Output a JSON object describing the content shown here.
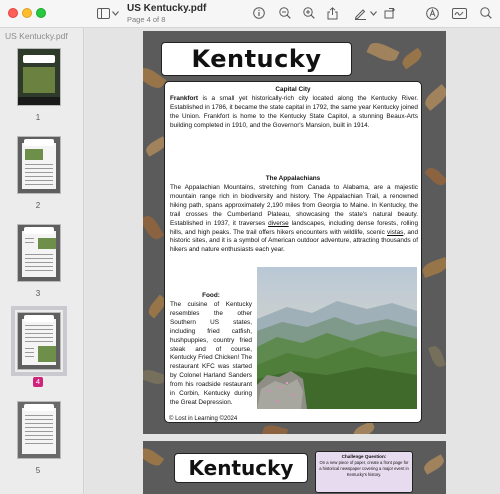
{
  "window": {
    "doc_title": "US Kentucky.pdf",
    "page_indicator": "Page 4 of 8"
  },
  "toolbar": {
    "icons": [
      "sidebar-toggle-icon",
      "chevron-down-icon",
      "info-icon",
      "zoom-out-icon",
      "zoom-in-icon",
      "share-icon",
      "markup-pen-icon",
      "chevron-down-icon",
      "rotate-icon",
      "highlight-icon",
      "signature-icon",
      "search-icon"
    ]
  },
  "sidebar": {
    "title": "US Kentucky.pdf",
    "thumbnails": [
      {
        "page": "1"
      },
      {
        "page": "2"
      },
      {
        "page": "3"
      },
      {
        "page": "4",
        "current": true
      },
      {
        "page": "5"
      }
    ]
  },
  "page": {
    "title": "Kentucky",
    "capital_heading": "Capital City",
    "capital_text": "is a small yet historically-rich city located along the Kentucky River. Established in 1786, it became the state capital in 1792, the same year Kentucky joined the Union. Frankfort is home to the Kentucky State Capitol, a stunning Beaux-Arts building completed in 1910, and the Governor's Mansion, built in 1914.",
    "capital_lead": "Frankfort",
    "appalachians_heading": "The Appalachians",
    "appalachians_text_1": "The Appalachian Mountains, stretching from Canada to Alabama, are a majestic mountain range rich in biodiversity and history. The Appalachian Trail, a renowned hiking path, spans approximately 2,190 miles from Georgia to Maine. In Kentucky, the trail crosses the Cumberland Plateau, showcasing the state's natural beauty. Established in 1937, it traverses",
    "appalachians_diverse": "diverse",
    "appalachians_text_2": "landscapes, including dense forests, rolling hills, and high peaks. The trail offers hikers encounters with wildlife, scenic",
    "appalachians_vistas": "vistas",
    "appalachians_text_3": ", and historic sites, and it is a symbol of American outdoor adventure, attracting thousands of hikers and nature enthusiasts each year.",
    "food_heading": "Food:",
    "food_text": "The cuisine of Kentucky resembles the other Southern US states, including fried catfish, hushpuppies, country fried steak and of course, Kentucky Fried Chicken! The restaurant KFC was started by Colonel Harland Sanders from his roadside restaurant in Corbin, Kentucky during the Great Depression.",
    "copyright": "© Lost in Learning ©2024"
  },
  "next_page": {
    "title": "Kentucky",
    "challenge_heading": "Challenge Question:",
    "challenge_text": "On a new piece of paper, create a front page for a historical newspaper covering a major event in Kentucky's history."
  },
  "colors": {
    "page_background": "#5b5b5b",
    "leaf_colors": [
      "#c98a3a",
      "#b5692a",
      "#d9a45c",
      "#8a7f5b"
    ],
    "current_page_badge": "#d0247b",
    "challenge_box": "#e7dbef"
  }
}
